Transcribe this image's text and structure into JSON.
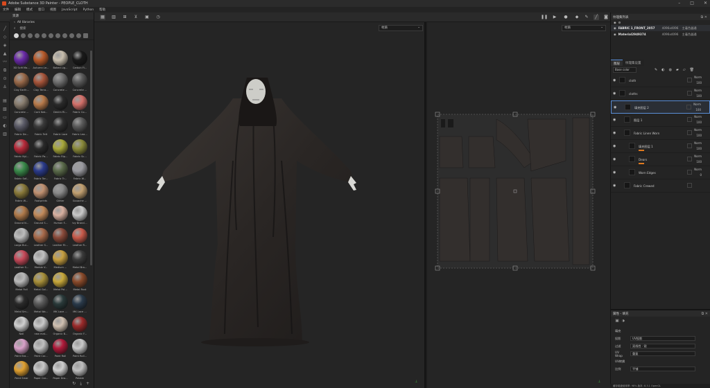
{
  "app": {
    "title": "Adobe Substance 3D Painter - PEOPLE_CLOTH",
    "window_controls": [
      "–",
      "□",
      "✕"
    ]
  },
  "menu": [
    "文件",
    "编辑",
    "模式",
    "窗口",
    "视图",
    "JavaScript",
    "Python",
    "帮助"
  ],
  "shelf": {
    "title": "资源",
    "library": "All libraries",
    "search_placeholder": "搜索",
    "materials": [
      {
        "label": "3D Scifi Ma...",
        "color": "#6a2aa8"
      },
      {
        "label": "Autumn Le...",
        "color": "#b85a2a"
      },
      {
        "label": "Baked Lig...",
        "color": "#c9bfae"
      },
      {
        "label": "Carbon Fi...",
        "color": "#1a1a1a"
      },
      {
        "label": "Clay Earth...",
        "color": "#9a6a4a"
      },
      {
        "label": "Clay Terra...",
        "color": "#a8553a"
      },
      {
        "label": "Concrete ...",
        "color": "#6f6f6f"
      },
      {
        "label": "Concrete ...",
        "color": "#5a5a5a"
      },
      {
        "label": "Concrete ...",
        "color": "#8a7e70"
      },
      {
        "label": "Cork Nat...",
        "color": "#b87a4a"
      },
      {
        "label": "Denim Ri...",
        "color": "#2a2a2a"
      },
      {
        "label": "Fabric Co...",
        "color": "#d4706a"
      },
      {
        "label": "Fabric De...",
        "color": "#5a5a66"
      },
      {
        "label": "Fabric Felt",
        "color": "#3a3a3a"
      },
      {
        "label": "Fabric Lace",
        "color": "#2f2f2f"
      },
      {
        "label": "Fabric Lea...",
        "color": "#5a5a5a"
      },
      {
        "label": "Fabric Nyl...",
        "color": "#b82a3a"
      },
      {
        "label": "Fabric Pa...",
        "color": "#2a2a2a"
      },
      {
        "label": "Fabric Rip...",
        "color": "#a8a83a"
      },
      {
        "label": "Fabric Sc...",
        "color": "#8a8a3a"
      },
      {
        "label": "Fabric Sof...",
        "color": "#3a8a4a"
      },
      {
        "label": "Fabric Tar...",
        "color": "#2a3a8a"
      },
      {
        "label": "Fabric Tr...",
        "color": "#5a6a4a"
      },
      {
        "label": "Fabric W...",
        "color": "#9a9aa0"
      },
      {
        "label": "Fabric W...",
        "color": "#8a7a3a"
      },
      {
        "label": "Footprints",
        "color": "#c09070"
      },
      {
        "label": "Glitter",
        "color": "#8a8a8a"
      },
      {
        "label": "Gouache ...",
        "color": "#c2a070"
      },
      {
        "label": "Ground N...",
        "color": "#b07a4a"
      },
      {
        "label": "Ground S...",
        "color": "#c28a5a"
      },
      {
        "label": "Human F...",
        "color": "#d8b0a0"
      },
      {
        "label": "Ivy Brancl...",
        "color": "#c9c9c9"
      },
      {
        "label": "Large Bui...",
        "color": "#bcbcbc"
      },
      {
        "label": "Leather S...",
        "color": "#a86a4a"
      },
      {
        "label": "Leather Ri...",
        "color": "#8a4a3a"
      },
      {
        "label": "Leather R...",
        "color": "#c85a4a"
      },
      {
        "label": "Leather S...",
        "color": "#c84a5a"
      },
      {
        "label": "Marble V...",
        "color": "#c2c2c2"
      },
      {
        "label": "Medium ...",
        "color": "#c8a040"
      },
      {
        "label": "Metal Bra...",
        "color": "#3a3a3a"
      },
      {
        "label": "Metal Foil",
        "color": "#b9b9b9"
      },
      {
        "label": "Metal Gol...",
        "color": "#a8903a"
      },
      {
        "label": "Metal Pol...",
        "color": "#c8a83a"
      },
      {
        "label": "Metal Rust",
        "color": "#8a4a2a"
      },
      {
        "label": "Metal Sm...",
        "color": "#2a2a2a"
      },
      {
        "label": "Metal Wo...",
        "color": "#5a5a5a"
      },
      {
        "label": "MK Lace ...",
        "color": "#2a3a3a"
      },
      {
        "label": "MK Lace ...",
        "color": "#2a3a4a"
      },
      {
        "label": "Nail",
        "color": "#d0d0d0"
      },
      {
        "label": "new mat...",
        "color": "#c9c9c9"
      },
      {
        "label": "Organic B...",
        "color": "#d0c0b0"
      },
      {
        "label": "Organic F...",
        "color": "#9a2a2a"
      },
      {
        "label": "Paint Bra...",
        "color": "#d8a0c8"
      },
      {
        "label": "Paint Cor...",
        "color": "#c0c0c0"
      },
      {
        "label": "Paint Roll",
        "color": "#b01a3a"
      },
      {
        "label": "Paint Roll...",
        "color": "#c9c9c9"
      },
      {
        "label": "Paint Smar",
        "color": "#e0a030"
      },
      {
        "label": "Paper Car...",
        "color": "#c8c8c8"
      },
      {
        "label": "Paper Dra...",
        "color": "#cfcfcf"
      },
      {
        "label": "Pebble",
        "color": "#bfbfbf"
      }
    ]
  },
  "viewport3d": {
    "channel": "材质"
  },
  "viewport2d": {
    "channel": "材质"
  },
  "texture_sets": {
    "title": "纹理集列表",
    "items": [
      {
        "name": "FABRIC 1_FRONT_2057",
        "res": "4096x4096",
        "shader": "主着色器通"
      },
      {
        "name": "Material2949374",
        "res": "4096x4096",
        "shader": "主着色器通"
      }
    ]
  },
  "layers": {
    "tabs": [
      "图层",
      "纹理集设置"
    ],
    "blend": "Base color",
    "rows": [
      {
        "name": "cloth",
        "mode": "Norm",
        "opacity": "100",
        "indent": 0
      },
      {
        "name": "cloths",
        "mode": "Norm",
        "opacity": "100",
        "indent": 0
      },
      {
        "name": "填充图层 2",
        "mode": "Norm",
        "opacity": "100",
        "indent": 1
      },
      {
        "name": "图层 1",
        "mode": "Norm",
        "opacity": "100",
        "indent": 1
      },
      {
        "name": "Fabric Linen Worn",
        "mode": "Norm",
        "opacity": "100",
        "indent": 1
      },
      {
        "name": "填充图层 1",
        "mode": "Norm",
        "opacity": "100",
        "indent": 2
      },
      {
        "name": "Dears",
        "mode": "Norm",
        "opacity": "100",
        "indent": 2
      },
      {
        "name": "Worn Edges",
        "mode": "Norm",
        "opacity": "0",
        "indent": 2
      },
      {
        "name": "Fabric Crewed",
        "mode": "",
        "opacity": "",
        "indent": 1
      }
    ]
  },
  "properties": {
    "title": "属性 - 填充",
    "section": "填充",
    "rows": [
      {
        "key": "投影",
        "value": "UV投影"
      },
      {
        "key": "过滤",
        "value": "双线性 · 锐"
      },
      {
        "key": "UV Wrap",
        "value": "重复"
      }
    ],
    "subsection": "UV转换",
    "scale_key": "比例",
    "scale_value": "平铺"
  },
  "status": {
    "text": "缓存磁盘使用率: 98%  版本: 8.3.1  OpenGL"
  }
}
